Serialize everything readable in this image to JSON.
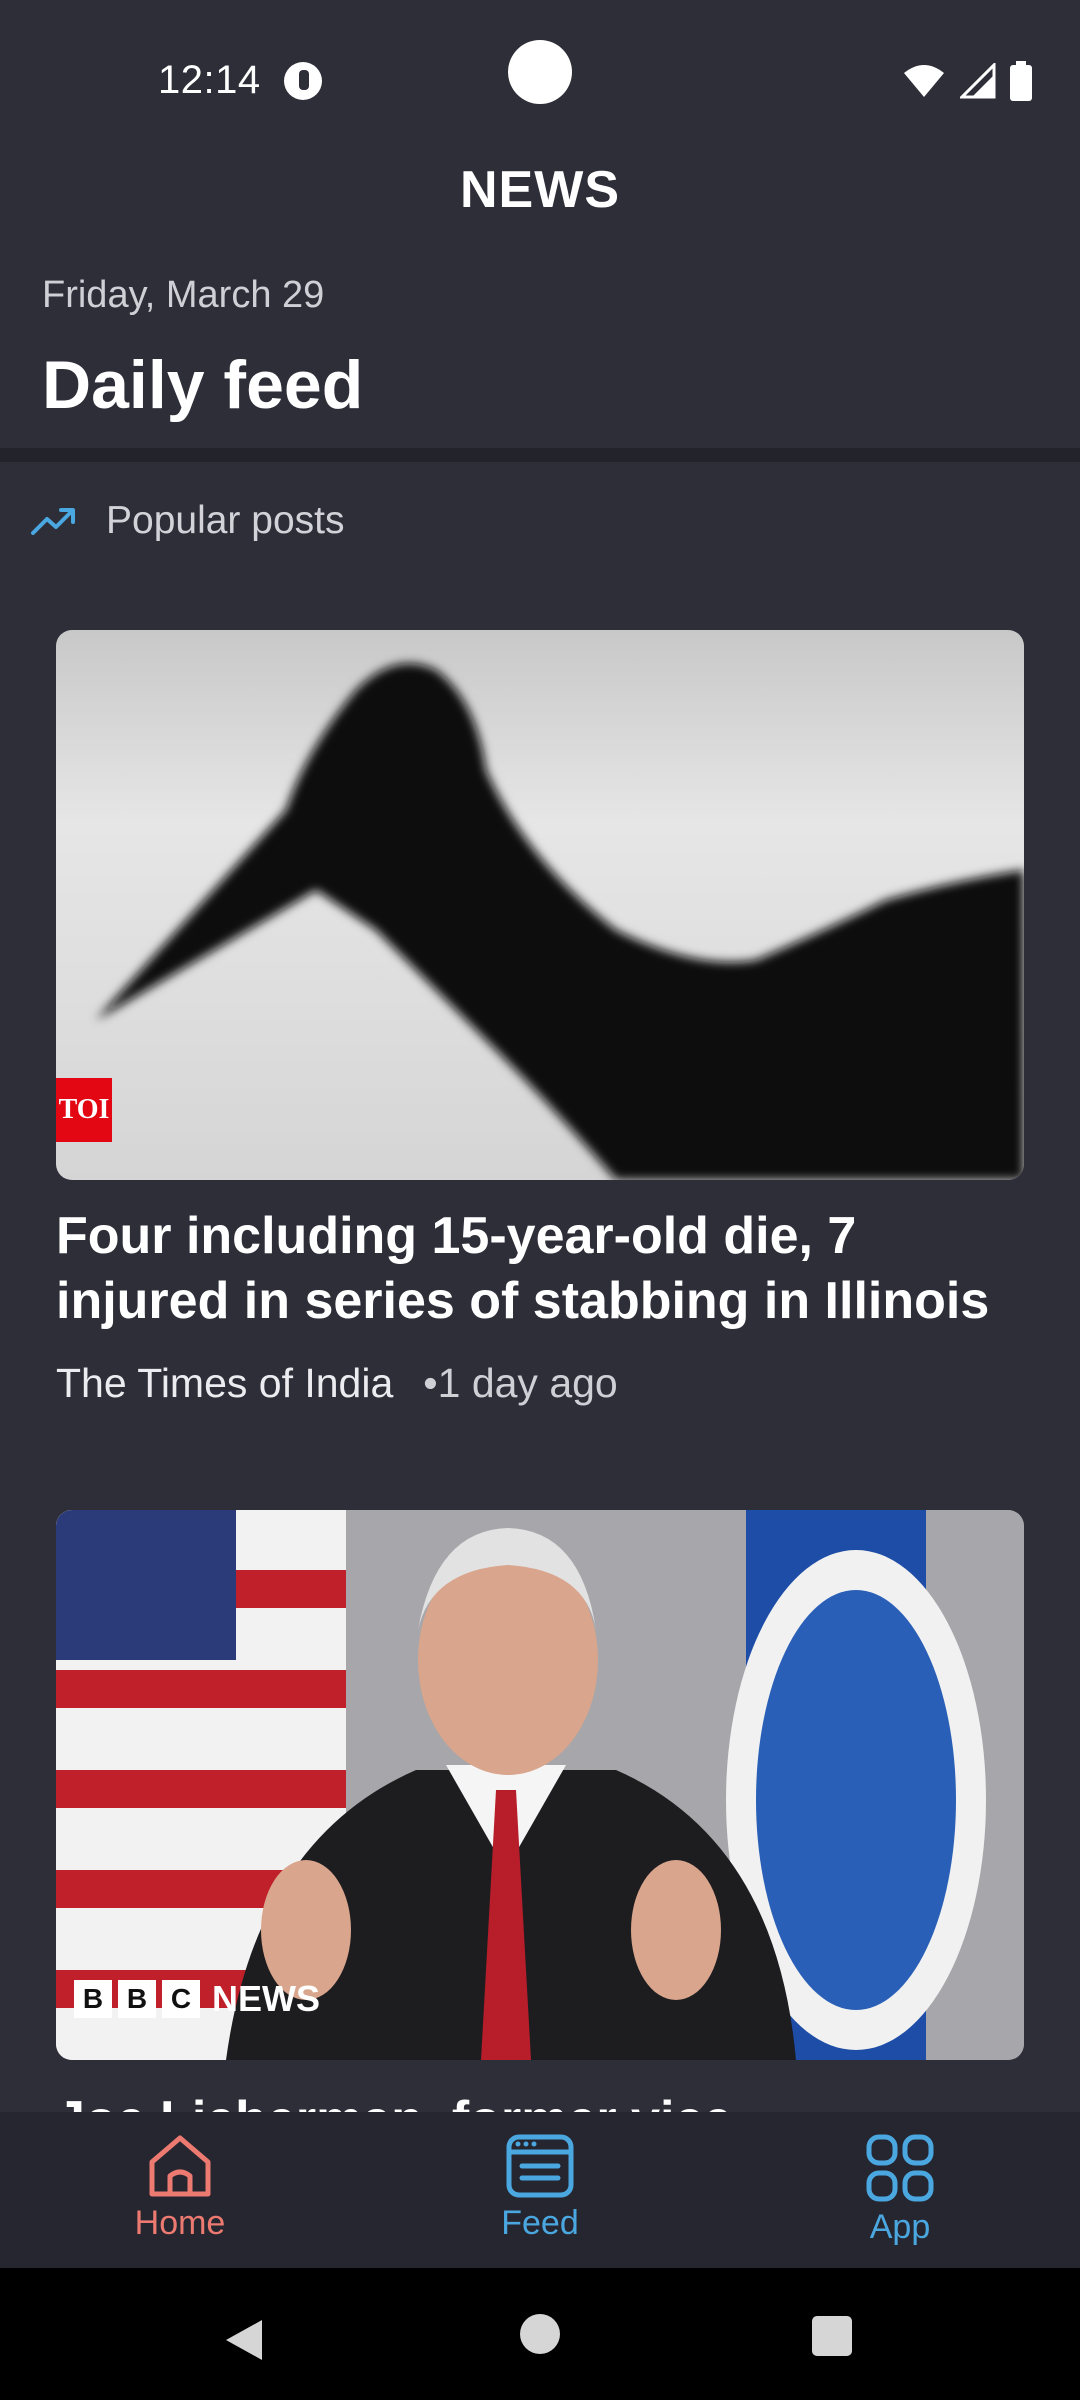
{
  "status_bar": {
    "time": "12:14"
  },
  "header": {
    "title": "NEWS",
    "date": "Friday, March 29",
    "heading": "Daily feed"
  },
  "section": {
    "label": "Popular posts",
    "icon": "trending-up-icon"
  },
  "articles": [
    {
      "title_lines": [
        "Four including 15-year-old die, 7",
        "injured in series of stabbing in Illinois"
      ],
      "source": "The Times of India",
      "time": "•1 day ago",
      "image_logo": "TOI"
    },
    {
      "title_partial": "Joe Lieberman, former vice",
      "image_logo": {
        "boxes": [
          "B",
          "B",
          "C"
        ],
        "word": "NEWS"
      }
    }
  ],
  "bottom_nav": [
    {
      "label": "Home",
      "icon": "home-icon",
      "active": true
    },
    {
      "label": "Feed",
      "icon": "feed-icon",
      "active": false
    },
    {
      "label": "App",
      "icon": "apps-grid-icon",
      "active": false
    }
  ],
  "colors": {
    "background": "#2e2e39",
    "nav_active": "#ec7a70",
    "nav_inactive": "#4aa7e0",
    "accent_icon": "#4aa7e0"
  }
}
